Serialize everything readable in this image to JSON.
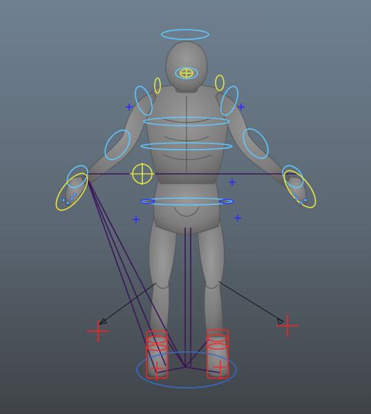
{
  "viewport": {
    "background_top": "#6f8090",
    "background_bottom": "#3f4347",
    "mesh_color": "#8a8a8a",
    "mesh_shadow": "#555555",
    "control_colors": {
      "cyan": "#5fc8ff",
      "yellow": "#e8e83c",
      "blue": "#2a2aff",
      "red": "#ff2222",
      "purple": "#3a1458",
      "black": "#111111"
    },
    "icons": [
      "head-halo-control",
      "ik-handle-cross",
      "pole-vector-locator",
      "foot-ik-control",
      "joint-chain"
    ]
  }
}
